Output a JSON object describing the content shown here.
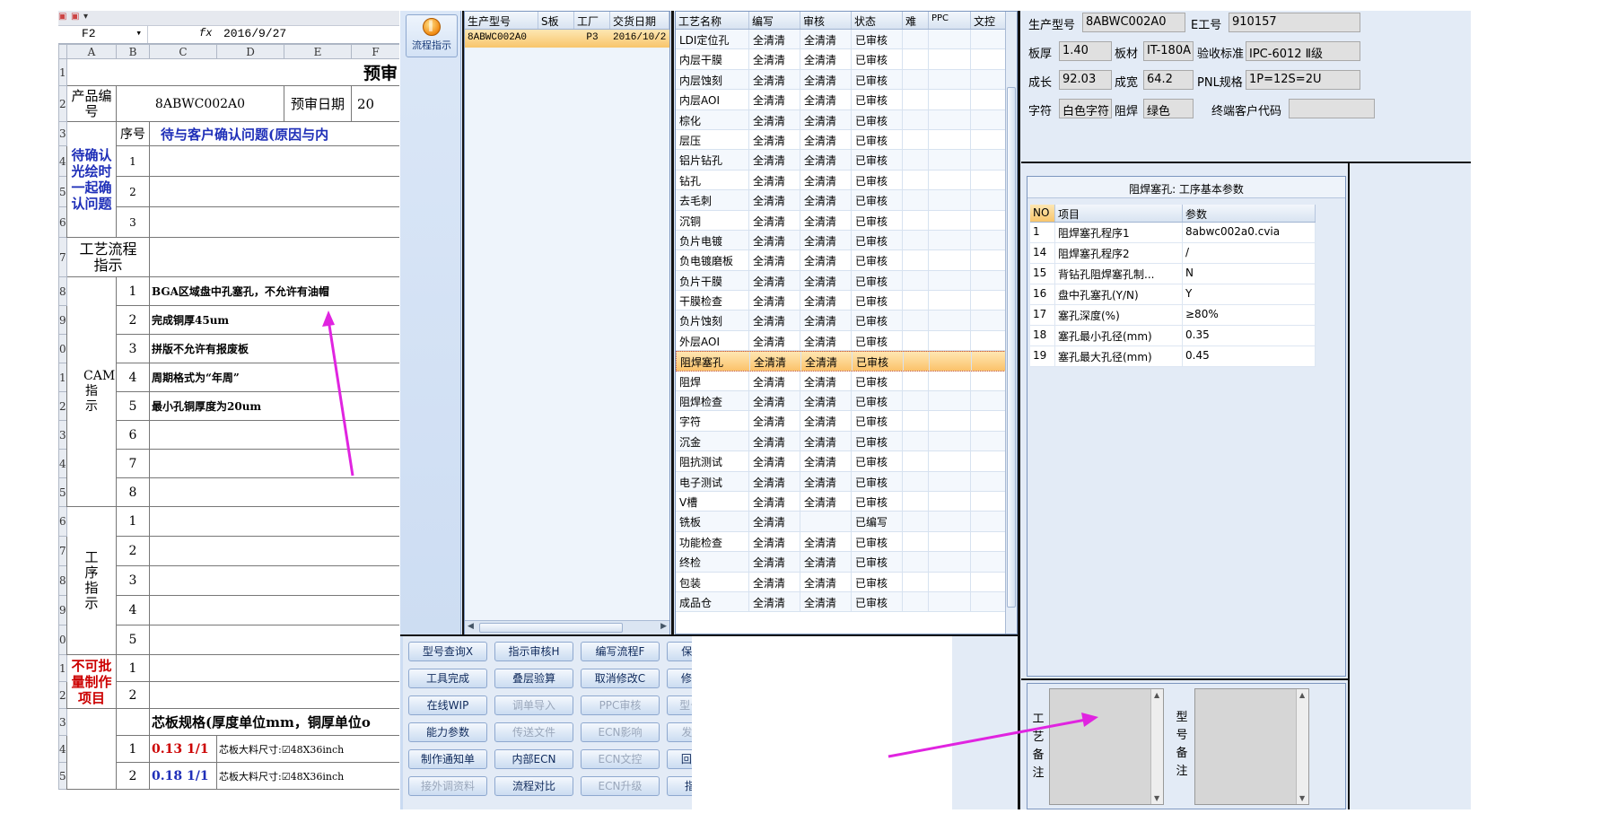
{
  "excel": {
    "cell_ref": "F2",
    "fx_symbol": "fx",
    "formula_value": "2016/9/27",
    "columns": [
      "A",
      "B",
      "C",
      "D",
      "E",
      "F"
    ],
    "title_partial": "预审",
    "product_no_label": "产品编号",
    "product_no_value": "8ABWC002A0",
    "review_date_label": "预审日期",
    "review_date_value": "20",
    "seq_label": "序号",
    "pending_header": "待与客户确认问题(原因与内",
    "pending_group": "待确认光绘时一起确认问题",
    "process_flow_label": "工艺流程指示",
    "cam_label": "CAM指示",
    "cam_items": [
      "BGA区域盘中孔塞孔，不允许有油帽",
      "完成铜厚45um",
      "拼版不允许有报废板",
      "周期格式为“年周”",
      "最小孔铜厚度为20um",
      "",
      "",
      ""
    ],
    "process_label": "工序指示",
    "nonbatch_label": "不可批量制作项目",
    "core_spec_header": "芯板规格(厚度单位mm，铜厚单位o",
    "core_rows": [
      {
        "no": "1",
        "spec": "0.13 1/1",
        "size_label": "芯板大料尺寸:",
        "size": "48X36inch"
      },
      {
        "no": "2",
        "spec": "0.18 1/1",
        "size_label": "芯板大料尺寸:",
        "size": "48X36inch"
      }
    ],
    "row_nums": [
      "1",
      "2",
      "3",
      "4",
      "5",
      "6",
      "7",
      "8",
      "9",
      "0",
      "1",
      "2",
      "3",
      "4",
      "5",
      "6",
      "7",
      "8",
      "9",
      "0",
      "1",
      "2",
      "3",
      "4",
      "5"
    ]
  },
  "flow_button": {
    "label": "流程指示"
  },
  "order_grid": {
    "headers": [
      "生产型号",
      "S板",
      "工厂",
      "交货日期"
    ],
    "rows": [
      {
        "model": "8ABWC002A0",
        "s_board": "",
        "factory": "P3",
        "delivery": "2016/10/2"
      }
    ]
  },
  "process_grid": {
    "headers": [
      "工艺名称",
      "编写",
      "审核",
      "状态",
      "难",
      "PPC",
      "文控"
    ],
    "selected_index": 17,
    "rows": [
      {
        "name": "LDI定位孔",
        "writer": "全清清",
        "reviewer": "全清清",
        "status": "已审核"
      },
      {
        "name": "内层干膜",
        "writer": "全清清",
        "reviewer": "全清清",
        "status": "已审核"
      },
      {
        "name": "内层蚀刻",
        "writer": "全清清",
        "reviewer": "全清清",
        "status": "已审核"
      },
      {
        "name": "内层AOI",
        "writer": "全清清",
        "reviewer": "全清清",
        "status": "已审核"
      },
      {
        "name": "棕化",
        "writer": "全清清",
        "reviewer": "全清清",
        "status": "已审核"
      },
      {
        "name": "层压",
        "writer": "全清清",
        "reviewer": "全清清",
        "status": "已审核"
      },
      {
        "name": "铝片钻孔",
        "writer": "全清清",
        "reviewer": "全清清",
        "status": "已审核"
      },
      {
        "name": "钻孔",
        "writer": "全清清",
        "reviewer": "全清清",
        "status": "已审核"
      },
      {
        "name": "去毛刺",
        "writer": "全清清",
        "reviewer": "全清清",
        "status": "已审核"
      },
      {
        "name": "沉铜",
        "writer": "全清清",
        "reviewer": "全清清",
        "status": "已审核"
      },
      {
        "name": "负片电镀",
        "writer": "全清清",
        "reviewer": "全清清",
        "status": "已审核"
      },
      {
        "name": "负电镀磨板",
        "writer": "全清清",
        "reviewer": "全清清",
        "status": "已审核"
      },
      {
        "name": "负片干膜",
        "writer": "全清清",
        "reviewer": "全清清",
        "status": "已审核"
      },
      {
        "name": "干膜检查",
        "writer": "全清清",
        "reviewer": "全清清",
        "status": "已审核"
      },
      {
        "name": "负片蚀刻",
        "writer": "全清清",
        "reviewer": "全清清",
        "status": "已审核"
      },
      {
        "name": "外层AOI",
        "writer": "全清清",
        "reviewer": "全清清",
        "status": "已审核"
      },
      {
        "name": "阻焊塞孔",
        "writer": "全清清",
        "reviewer": "全清清",
        "status": "已审核"
      },
      {
        "name": "阻焊",
        "writer": "全清清",
        "reviewer": "全清清",
        "status": "已审核"
      },
      {
        "name": "阻焊检查",
        "writer": "全清清",
        "reviewer": "全清清",
        "status": "已审核"
      },
      {
        "name": "字符",
        "writer": "全清清",
        "reviewer": "全清清",
        "status": "已审核"
      },
      {
        "name": "沉金",
        "writer": "全清清",
        "reviewer": "全清清",
        "status": "已审核"
      },
      {
        "name": "阻抗测试",
        "writer": "全清清",
        "reviewer": "全清清",
        "status": "已审核"
      },
      {
        "name": "电子测试",
        "writer": "全清清",
        "reviewer": "全清清",
        "status": "已审核"
      },
      {
        "name": "V槽",
        "writer": "全清清",
        "reviewer": "全清清",
        "status": "已审核"
      },
      {
        "name": "铣板",
        "writer": "全清清",
        "reviewer": "",
        "status": "已编写"
      },
      {
        "name": "功能检查",
        "writer": "全清清",
        "reviewer": "全清清",
        "status": "已审核"
      },
      {
        "name": "终检",
        "writer": "全清清",
        "reviewer": "全清清",
        "status": "已审核"
      },
      {
        "name": "包装",
        "writer": "全清清",
        "reviewer": "全清清",
        "status": "已审核"
      },
      {
        "name": "成品仓",
        "writer": "全清清",
        "reviewer": "全清清",
        "status": "已审核"
      }
    ]
  },
  "buttons": [
    {
      "label": "型号查询X",
      "enabled": true
    },
    {
      "label": "指示审核H",
      "enabled": true
    },
    {
      "label": "编写流程F",
      "enabled": true
    },
    {
      "label": "保存信息S",
      "enabled": true
    },
    {
      "label": "工具完成",
      "enabled": true
    },
    {
      "label": "叠层验算",
      "enabled": true
    },
    {
      "label": "取消修改C",
      "enabled": true
    },
    {
      "label": "修改信息R",
      "enabled": true
    },
    {
      "label": "在线WIP",
      "enabled": true
    },
    {
      "label": "调单导入",
      "enabled": false
    },
    {
      "label": "PPC审核",
      "enabled": false
    },
    {
      "label": "型号上网W",
      "enabled": false
    },
    {
      "label": "能力参数",
      "enabled": true
    },
    {
      "label": "传送文件",
      "enabled": false
    },
    {
      "label": "ECN影响",
      "enabled": false
    },
    {
      "label": "发送指示Y",
      "enabled": false
    },
    {
      "label": "制作通知单",
      "enabled": true
    },
    {
      "label": "内部ECN",
      "enabled": true
    },
    {
      "label": "ECN文控",
      "enabled": false
    },
    {
      "label": "回退审核B",
      "enabled": true
    },
    {
      "label": "接外调资料",
      "enabled": false
    },
    {
      "label": "流程对比",
      "enabled": true
    },
    {
      "label": "ECN升级",
      "enabled": false
    },
    {
      "label": "指示检查",
      "enabled": true
    }
  ],
  "info": {
    "model_label": "生产型号",
    "model_value": "8ABWC002A0",
    "eno_label": "E工号",
    "eno_value": "910157",
    "thickness_label": "板厚",
    "thickness_value": "1.40",
    "material_label": "板材",
    "material_value": "IT-180A",
    "standard_label": "验收标准",
    "standard_value": "IPC-6012 Ⅱ级",
    "length_label": "成长",
    "length_value": "92.03",
    "width_label": "成宽",
    "width_value": "64.2",
    "pnl_label": "PNL规格",
    "pnl_value": "1P=12S=2U",
    "char_label": "字符",
    "char_value": "白色字符",
    "solder_label": "阻焊",
    "solder_value": "绿色",
    "enduser_label": "终端客户代码",
    "enduser_value": ""
  },
  "params": {
    "title": "阻焊塞孔: 工序基本参数",
    "headers": [
      "NO",
      "项目",
      "参数"
    ],
    "rows": [
      {
        "no": "1",
        "item": "阻焊塞孔程序1",
        "value": "8abwc002a0.cvia"
      },
      {
        "no": "14",
        "item": "阻焊塞孔程序2",
        "value": "/"
      },
      {
        "no": "15",
        "item": "背钻孔阻焊塞孔制...",
        "value": "N"
      },
      {
        "no": "16",
        "item": "盘中孔塞孔(Y/N)",
        "value": "Y"
      },
      {
        "no": "17",
        "item": "塞孔深度(%)",
        "value": "≥80%"
      },
      {
        "no": "18",
        "item": "塞孔最小孔径(mm)",
        "value": "0.35"
      },
      {
        "no": "19",
        "item": "塞孔最大孔径(mm)",
        "value": "0.45"
      }
    ]
  },
  "remarks": {
    "process_label": "工艺备注",
    "process_chars": [
      "工",
      "艺",
      "备",
      "注"
    ],
    "model_chars": [
      "型",
      "号",
      "备",
      "注"
    ],
    "process_text": "",
    "model_text": ""
  },
  "colors": {
    "accent_selection": "#fbc26a",
    "annotation_arrow": "#e024e0",
    "excel_blue": "#1f2fb8",
    "excel_red": "#cc0000"
  }
}
